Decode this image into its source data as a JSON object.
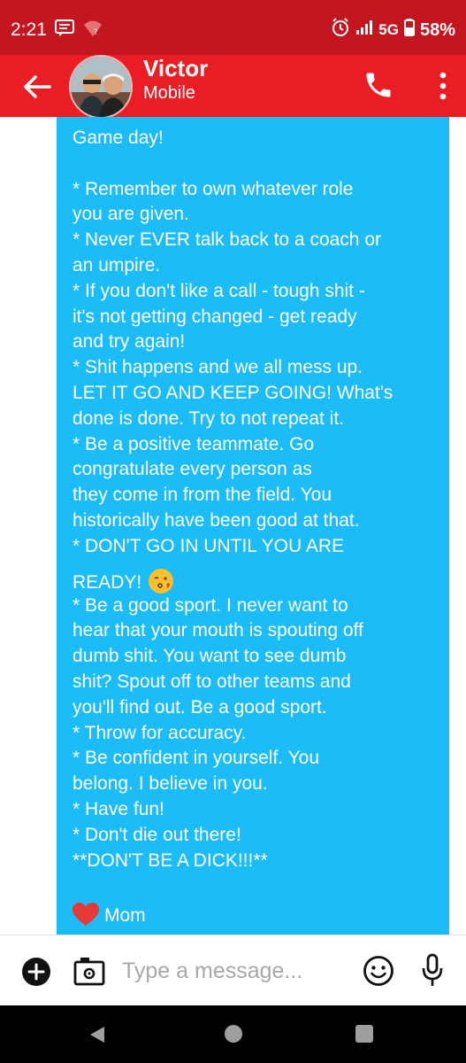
{
  "status_bar": {
    "time": "2:21",
    "network": "5G",
    "battery": "58%",
    "icons": [
      "message-notification-icon",
      "wifi-question-icon",
      "alarm-icon",
      "signal-icon",
      "battery-icon"
    ]
  },
  "header": {
    "contact_name": "Victor",
    "contact_subtitle": "Mobile",
    "icons": [
      "back-arrow-icon",
      "avatar",
      "phone-icon",
      "more-vert-icon"
    ],
    "colors": {
      "status_bar": "#c41620",
      "app_bar": "#ea1c24"
    }
  },
  "conversation": {
    "bubble_color": "#1cbcf8",
    "lines": [
      "Game day!",
      "",
      "* Remember to own whatever role",
      "you are given.",
      "* Never EVER talk back to a coach or",
      "an umpire.",
      "* If you don't like a call - tough shit -",
      "it's not getting changed - get ready",
      "and try again!",
      "* Shit happens and we all mess up.",
      "LET IT GO AND KEEP GOING! What's",
      "done is done. Try to not repeat it.",
      "* Be a positive teammate. Go",
      "congratulate every person as",
      "they come in from the field. You",
      "historically have been good at that.",
      "* DON'T GO IN UNTIL YOU ARE"
    ],
    "ready_line": "READY!",
    "lines_after": [
      "* Be a good sport. I never want to",
      "hear that your mouth is spouting off",
      "dumb shit. You want to see dumb",
      "shit? Spout off to other teams and",
      "you'll find out. Be a good sport.",
      "* Throw for accuracy.",
      "* Be confident in yourself. You",
      "belong. I believe in you.",
      "* Have fun!",
      "* Don't die out there!",
      "**DON'T BE A DICK!!!**",
      ""
    ],
    "signature": "Mom"
  },
  "composer": {
    "placeholder": "Type a message..."
  }
}
